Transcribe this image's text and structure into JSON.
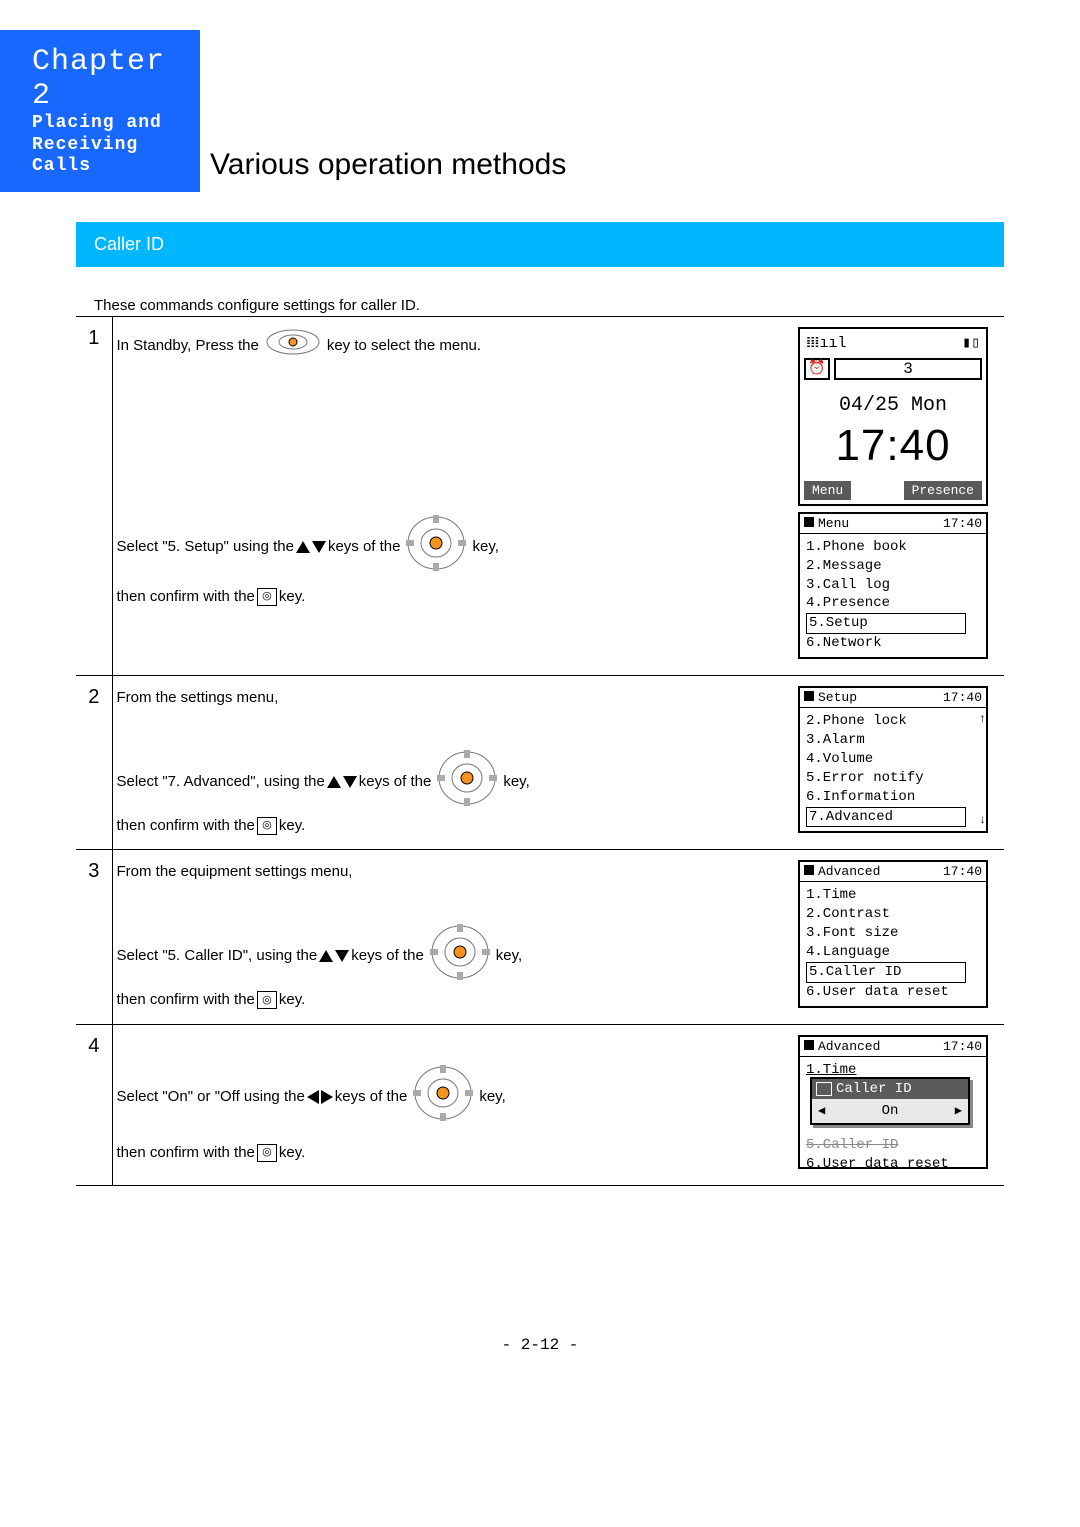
{
  "header": {
    "chapter": "Chapter 2",
    "subtitle_line1": "Placing and",
    "subtitle_line2": "Receiving Calls",
    "page_title": "Various operation methods"
  },
  "section_title": "Caller ID",
  "intro": "These commands configure settings for caller ID.",
  "steps": {
    "s1": {
      "num": "1",
      "text_a": "In Standby, Press the",
      "text_b": "key to select the menu.",
      "text_c1": "Select \"5. Setup\" using the",
      "text_c2": "keys of the",
      "text_c3": "key,",
      "text_d1": "then confirm with the",
      "text_d2": "key."
    },
    "s2": {
      "num": "2",
      "text_a": "From the settings menu,",
      "text_c1": "Select \"7. Advanced\", using the",
      "text_c2": "keys of the",
      "text_c3": "key,",
      "text_d1": "then confirm with the",
      "text_d2": "key."
    },
    "s3": {
      "num": "3",
      "text_a": "From the equipment settings menu,",
      "text_c1": "Select \"5. Caller ID\", using the",
      "text_c2": "keys of the",
      "text_c3": "key,",
      "text_d1": "then confirm with the",
      "text_d2": "key."
    },
    "s4": {
      "num": "4",
      "text_c1": "Select \"On\" or \"Off using the",
      "text_c2": "keys of the",
      "text_c3": "key,",
      "text_d1": "then confirm with the",
      "text_d2": "key."
    }
  },
  "screens": {
    "standby": {
      "badge": "3",
      "date": "04/25 Mon",
      "time": "17:40",
      "sk_left": "Menu",
      "sk_right": "Presence"
    },
    "menu": {
      "title": "Menu",
      "time": "17:40",
      "items": [
        "1.Phone book",
        "2.Message",
        "3.Call log",
        "4.Presence",
        "5.Setup",
        "6.Network"
      ],
      "selected_index": 4
    },
    "setup": {
      "title": "Setup",
      "time": "17:40",
      "items": [
        "2.Phone lock",
        "3.Alarm",
        "4.Volume",
        "5.Error notify",
        "6.Information",
        "7.Advanced"
      ],
      "selected_index": 5
    },
    "advanced": {
      "title": "Advanced",
      "time": "17:40",
      "items": [
        "1.Time",
        "2.Contrast",
        "3.Font size",
        "4.Language",
        "5.Caller ID",
        "6.User data reset"
      ],
      "selected_index": 4
    },
    "advanced_popup": {
      "title": "Advanced",
      "time": "17:40",
      "bg_top": "1.Time",
      "bg_bottom_a": "5.Caller ID",
      "bg_bottom_b": "6.User data reset",
      "popup_title": "Caller ID",
      "popup_value": "On"
    }
  },
  "footer": "- 2-12 -"
}
